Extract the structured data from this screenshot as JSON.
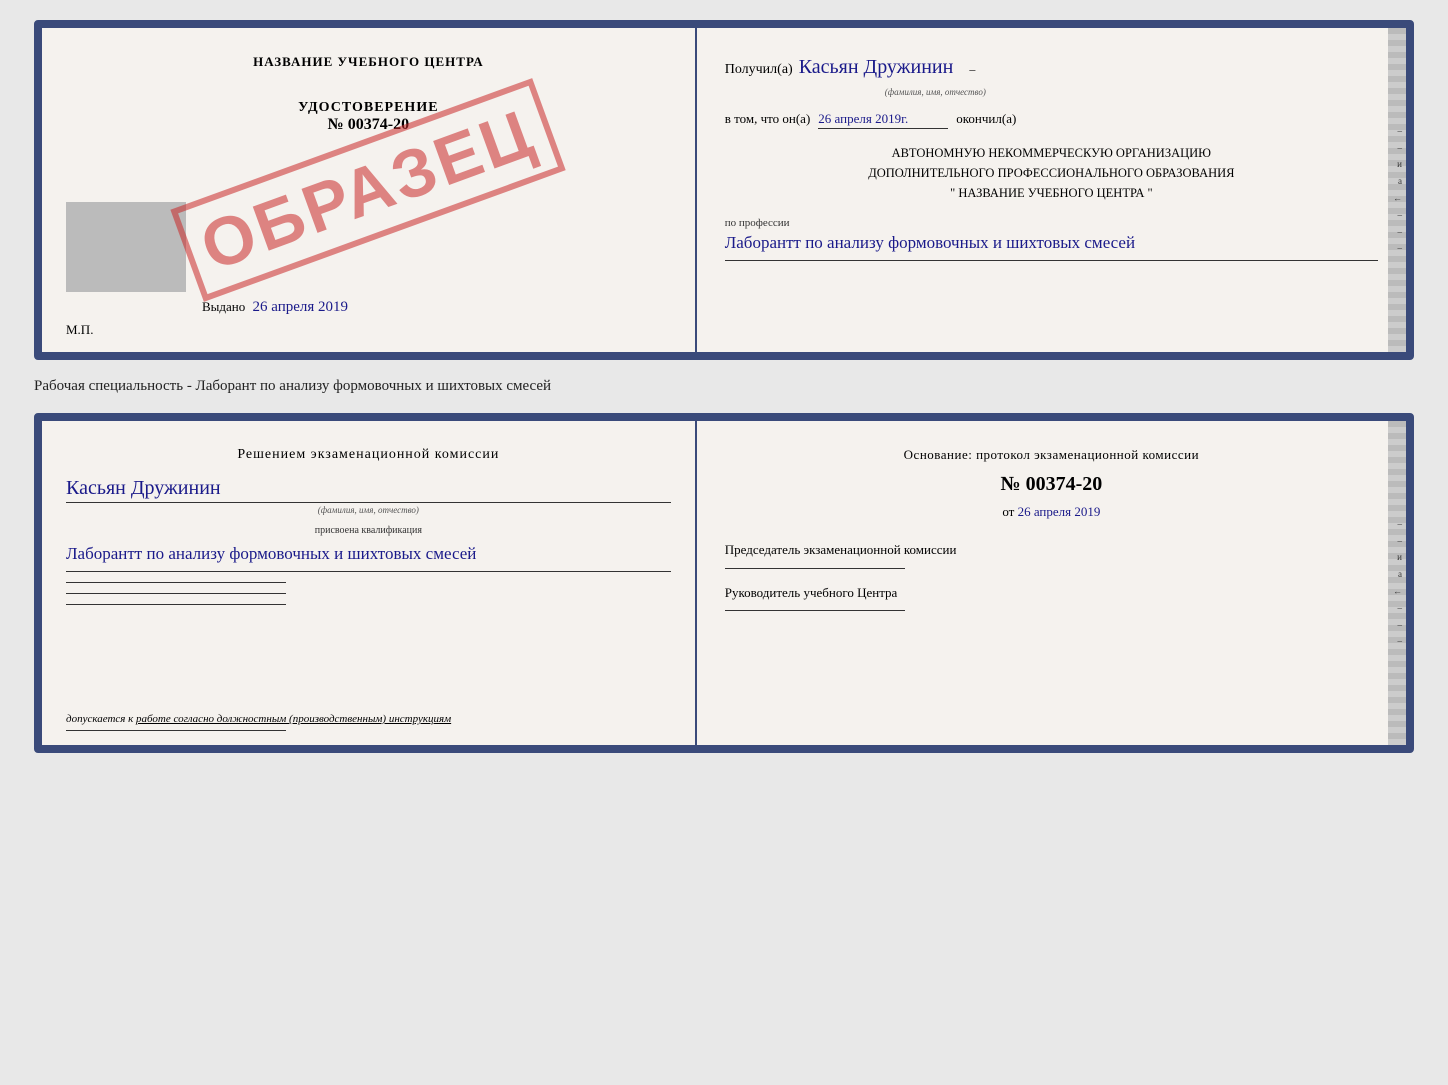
{
  "top_card": {
    "left": {
      "title": "НАЗВАНИЕ УЧЕБНОГО ЦЕНТРА",
      "cert_label": "УДОСТОВЕРЕНИЕ",
      "cert_number": "№ 00374-20",
      "issued_label": "Выдано",
      "issued_date": "26 апреля 2019",
      "mp_label": "М.П.",
      "stamp_text": "ОБРАЗЕЦ"
    },
    "right": {
      "received_prefix": "Получил(а)",
      "recipient_name": "Касьян Дружинин",
      "fio_label": "(фамилия, имя, отчество)",
      "date_prefix": "в том, что он(а)",
      "completion_date": "26 апреля 2019г.",
      "completed_label": "окончил(а)",
      "org_line1": "АВТОНОМНУЮ НЕКОММЕРЧЕСКУЮ ОРГАНИЗАЦИЮ",
      "org_line2": "ДОПОЛНИТЕЛЬНОГО ПРОФЕССИОНАЛЬНОГО ОБРАЗОВАНИЯ",
      "org_line3": "\"  НАЗВАНИЕ УЧЕБНОГО ЦЕНТРА  \"",
      "profession_prefix": "по профессии",
      "profession": "Лаборантт по анализу формовочных и шихтовых смесей"
    }
  },
  "middle_label": "Рабочая специальность - Лаборант по анализу формовочных и шихтовых смесей",
  "bottom_card": {
    "left": {
      "decision_text": "Решением экзаменационной комиссии",
      "name": "Касьян Дружинин",
      "fio_label": "(фамилия, имя, отчество)",
      "qualif_label": "присвоена квалификация",
      "qualification": "Лаборантт по анализу формовочных и шихтовых смесей",
      "allow_prefix": "допускается к",
      "allow_text": "работе согласно должностным (производственным) инструкциям"
    },
    "right": {
      "osnov_text": "Основание: протокол экзаменационной комиссии",
      "number_label": "№ 00374-20",
      "date_prefix": "от",
      "date": "26 апреля 2019",
      "chairman_label": "Председатель экзаменационной комиссии",
      "director_label": "Руководитель учебного Центра"
    }
  },
  "side_marks": {
    "marks": [
      "–",
      "–",
      "и",
      "а",
      "←",
      "–",
      "–",
      "–"
    ]
  }
}
